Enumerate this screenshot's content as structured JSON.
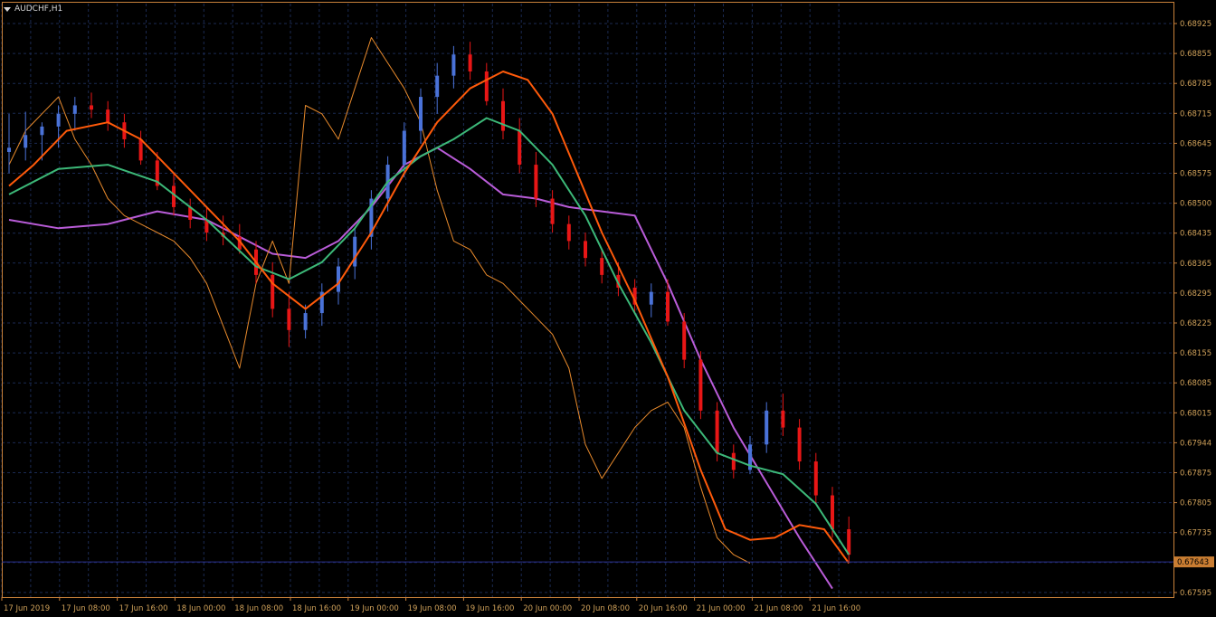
{
  "window": {
    "title": "AUDCHF,H1",
    "menu_icon": "triangle-down-icon"
  },
  "colors": {
    "background": "#000000",
    "grid": "#1b2a52",
    "frame": "#c8813a",
    "axis_text": "#cfa15a",
    "bull_candle": "#4a72d8",
    "bear_candle": "#e81616",
    "ma_fast": "#ff5a0a",
    "ma_medium": "#3cb878",
    "ma_slow": "#b95cd8",
    "price_line": "#e88a2c",
    "current_price_line": "#2b2f8a",
    "price_tag_bg": "#c97d32"
  },
  "price_axis": {
    "labels": [
      "0.68925",
      "0.68855",
      "0.68785",
      "0.68715",
      "0.68645",
      "0.68575",
      "0.68500",
      "0.68435",
      "0.68365",
      "0.68295",
      "0.68225",
      "0.68155",
      "0.68085",
      "0.68015",
      "0.67944",
      "0.67875",
      "0.67805",
      "0.67735",
      "0.67665",
      "0.67595"
    ],
    "current_price": "0.67643"
  },
  "time_axis": {
    "labels": [
      "17 Jun 2019",
      "17 Jun 08:00",
      "17 Jun 16:00",
      "18 Jun 00:00",
      "18 Jun 08:00",
      "18 Jun 16:00",
      "19 Jun 00:00",
      "19 Jun 08:00",
      "19 Jun 16:00",
      "20 Jun 00:00",
      "20 Jun 08:00",
      "20 Jun 16:00",
      "21 Jun 00:00",
      "21 Jun 08:00",
      "21 Jun 16:00"
    ]
  },
  "chart_data": {
    "type": "line",
    "symbol": "AUDCHF",
    "timeframe": "H1",
    "ylim": [
      0.6756,
      0.6896
    ],
    "series": [
      {
        "kind": "candles",
        "ohlc": [
          [
            0.6861,
            0.687,
            0.6856,
            0.6862
          ],
          [
            0.6862,
            0.68705,
            0.6859,
            0.6865
          ],
          [
            0.6865,
            0.6868,
            0.6859,
            0.6867
          ],
          [
            0.6867,
            0.6872,
            0.6862,
            0.687
          ],
          [
            0.687,
            0.6874,
            0.6866,
            0.6872
          ],
          [
            0.6872,
            0.6875,
            0.6869,
            0.6871
          ],
          [
            0.6871,
            0.6873,
            0.6866,
            0.6868
          ],
          [
            0.6868,
            0.687,
            0.6862,
            0.6864
          ],
          [
            0.6864,
            0.6866,
            0.6858,
            0.6859
          ],
          [
            0.6859,
            0.6861,
            0.6852,
            0.6853
          ],
          [
            0.6853,
            0.6856,
            0.6846,
            0.6848
          ],
          [
            0.6848,
            0.685,
            0.6843,
            0.6845
          ],
          [
            0.6845,
            0.6848,
            0.684,
            0.6842
          ],
          [
            0.6842,
            0.6846,
            0.6839,
            0.6841
          ],
          [
            0.6841,
            0.6844,
            0.6837,
            0.6838
          ],
          [
            0.6838,
            0.684,
            0.683,
            0.6832
          ],
          [
            0.6832,
            0.6835,
            0.6822,
            0.6824
          ],
          [
            0.6824,
            0.6828,
            0.6815,
            0.6819
          ],
          [
            0.6819,
            0.6825,
            0.6817,
            0.6823
          ],
          [
            0.6823,
            0.683,
            0.682,
            0.6828
          ],
          [
            0.6828,
            0.6836,
            0.6825,
            0.6834
          ],
          [
            0.6834,
            0.6843,
            0.6831,
            0.6841
          ],
          [
            0.6841,
            0.6852,
            0.6838,
            0.685
          ],
          [
            0.685,
            0.686,
            0.6847,
            0.6858
          ],
          [
            0.6858,
            0.6868,
            0.6855,
            0.6866
          ],
          [
            0.6866,
            0.6876,
            0.6863,
            0.6874
          ],
          [
            0.6874,
            0.6882,
            0.687,
            0.6879
          ],
          [
            0.6879,
            0.6886,
            0.6876,
            0.6884
          ],
          [
            0.6884,
            0.6887,
            0.6878,
            0.688
          ],
          [
            0.688,
            0.6882,
            0.6872,
            0.6873
          ],
          [
            0.6873,
            0.6876,
            0.6864,
            0.6866
          ],
          [
            0.6866,
            0.6869,
            0.6856,
            0.6858
          ],
          [
            0.6858,
            0.6861,
            0.6848,
            0.685
          ],
          [
            0.685,
            0.6852,
            0.6842,
            0.6844
          ],
          [
            0.6844,
            0.6846,
            0.6838,
            0.684
          ],
          [
            0.684,
            0.6842,
            0.6834,
            0.6836
          ],
          [
            0.6836,
            0.6838,
            0.683,
            0.6832
          ],
          [
            0.6832,
            0.6835,
            0.6827,
            0.6829
          ],
          [
            0.6829,
            0.6831,
            0.6823,
            0.6825
          ],
          [
            0.6825,
            0.683,
            0.6822,
            0.6828
          ],
          [
            0.6828,
            0.6831,
            0.682,
            0.6821
          ],
          [
            0.6821,
            0.6823,
            0.681,
            0.6812
          ],
          [
            0.6812,
            0.6814,
            0.6798,
            0.68
          ],
          [
            0.68,
            0.6802,
            0.6788,
            0.679
          ],
          [
            0.679,
            0.6792,
            0.6784,
            0.6786
          ],
          [
            0.6786,
            0.6794,
            0.6785,
            0.6792
          ],
          [
            0.6792,
            0.6802,
            0.679,
            0.68
          ],
          [
            0.68,
            0.6804,
            0.6794,
            0.6796
          ],
          [
            0.6796,
            0.6798,
            0.6786,
            0.6788
          ],
          [
            0.6788,
            0.679,
            0.6778,
            0.678
          ],
          [
            0.678,
            0.6782,
            0.677,
            0.6772
          ],
          [
            0.6772,
            0.6775,
            0.6764,
            0.6766
          ]
        ]
      },
      {
        "kind": "line",
        "role": "ma_fast",
        "values": [
          [
            0,
            0.6853
          ],
          [
            1.5,
            0.6858
          ],
          [
            3.5,
            0.6866
          ],
          [
            6,
            0.6868
          ],
          [
            8,
            0.6864
          ],
          [
            10,
            0.6856
          ],
          [
            12,
            0.6848
          ],
          [
            14,
            0.684
          ],
          [
            16,
            0.683
          ],
          [
            18,
            0.6824
          ],
          [
            20,
            0.683
          ],
          [
            22,
            0.6842
          ],
          [
            24,
            0.6856
          ],
          [
            26,
            0.6868
          ],
          [
            28,
            0.6876
          ],
          [
            30,
            0.688
          ],
          [
            31.5,
            0.6878
          ],
          [
            33,
            0.687
          ],
          [
            34.5,
            0.6856
          ],
          [
            36,
            0.6842
          ],
          [
            38,
            0.6826
          ],
          [
            40,
            0.6808
          ],
          [
            42,
            0.6786
          ],
          [
            43.5,
            0.6772
          ],
          [
            45,
            0.67695
          ],
          [
            46.5,
            0.677
          ],
          [
            48,
            0.6773
          ],
          [
            49.5,
            0.6772
          ],
          [
            51,
            0.6764
          ]
        ]
      },
      {
        "kind": "line",
        "role": "ma_medium",
        "values": [
          [
            0,
            0.6851
          ],
          [
            3,
            0.6857
          ],
          [
            6,
            0.6858
          ],
          [
            9,
            0.6854
          ],
          [
            12,
            0.6845
          ],
          [
            15,
            0.6834
          ],
          [
            17,
            0.6831
          ],
          [
            19,
            0.6835
          ],
          [
            21,
            0.6843
          ],
          [
            23,
            0.6854
          ],
          [
            25,
            0.686
          ],
          [
            27,
            0.6864
          ],
          [
            29,
            0.6869
          ],
          [
            31,
            0.6866
          ],
          [
            33,
            0.6858
          ],
          [
            35,
            0.6846
          ],
          [
            37,
            0.683
          ],
          [
            39,
            0.6816
          ],
          [
            41,
            0.68
          ],
          [
            43,
            0.679
          ],
          [
            45,
            0.6787
          ],
          [
            47,
            0.6785
          ],
          [
            49,
            0.6778
          ],
          [
            51,
            0.6766
          ]
        ]
      },
      {
        "kind": "line",
        "role": "ma_slow",
        "values": [
          [
            0,
            0.6845
          ],
          [
            3,
            0.6843
          ],
          [
            6,
            0.6844
          ],
          [
            9,
            0.6847
          ],
          [
            12,
            0.6845
          ],
          [
            14,
            0.6841
          ],
          [
            16,
            0.6837
          ],
          [
            18,
            0.6836
          ],
          [
            20,
            0.684
          ],
          [
            22,
            0.6848
          ],
          [
            24,
            0.6858
          ],
          [
            26,
            0.6862
          ],
          [
            28,
            0.6857
          ],
          [
            30,
            0.6851
          ],
          [
            32,
            0.685
          ],
          [
            34,
            0.6848
          ],
          [
            36,
            0.6847
          ],
          [
            38,
            0.6846
          ],
          [
            40,
            0.683
          ],
          [
            42,
            0.6812
          ],
          [
            44,
            0.6796
          ],
          [
            46,
            0.6783
          ],
          [
            48,
            0.677
          ],
          [
            50,
            0.6758
          ]
        ]
      },
      {
        "kind": "line",
        "role": "price_line",
        "values": [
          [
            0,
            0.6858
          ],
          [
            1,
            0.6866
          ],
          [
            2,
            0.687
          ],
          [
            3,
            0.6874
          ],
          [
            4,
            0.6864
          ],
          [
            5,
            0.6858
          ],
          [
            6,
            0.685
          ],
          [
            7,
            0.6846
          ],
          [
            8,
            0.6844
          ],
          [
            9,
            0.6842
          ],
          [
            10,
            0.684
          ],
          [
            11,
            0.6836
          ],
          [
            12,
            0.683
          ],
          [
            13,
            0.682
          ],
          [
            14,
            0.681
          ],
          [
            15,
            0.683
          ],
          [
            16,
            0.684
          ],
          [
            17,
            0.683
          ],
          [
            18,
            0.6872
          ],
          [
            19,
            0.687
          ],
          [
            20,
            0.6864
          ],
          [
            21,
            0.6876
          ],
          [
            22,
            0.6888
          ],
          [
            23,
            0.6882
          ],
          [
            24,
            0.6876
          ],
          [
            25,
            0.6868
          ],
          [
            26,
            0.6852
          ],
          [
            27,
            0.684
          ],
          [
            28,
            0.6838
          ],
          [
            29,
            0.6832
          ],
          [
            30,
            0.683
          ],
          [
            31,
            0.6826
          ],
          [
            32,
            0.6822
          ],
          [
            33,
            0.6818
          ],
          [
            34,
            0.681
          ],
          [
            35,
            0.6792
          ],
          [
            36,
            0.6784
          ],
          [
            37,
            0.679
          ],
          [
            38,
            0.6796
          ],
          [
            39,
            0.68
          ],
          [
            40,
            0.6802
          ],
          [
            41,
            0.6796
          ],
          [
            42,
            0.6782
          ],
          [
            43,
            0.677
          ],
          [
            44,
            0.6766
          ],
          [
            45,
            0.6764
          ]
        ]
      }
    ]
  }
}
